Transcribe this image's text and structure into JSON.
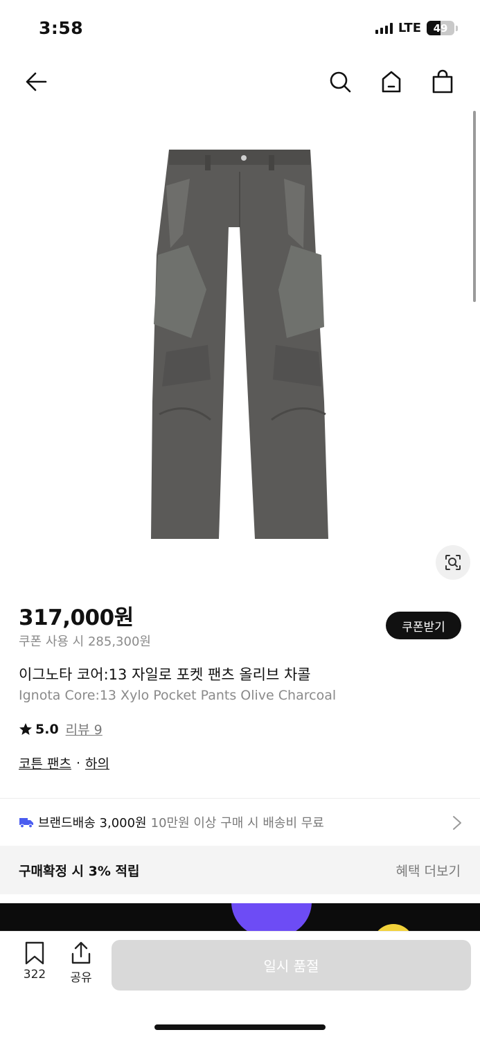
{
  "status_bar": {
    "time": "3:58",
    "network": "LTE",
    "battery": "49",
    "battery_level": 0.49
  },
  "nav": {
    "icons": [
      "back-arrow-icon",
      "search-icon",
      "home-icon",
      "shopping-bag-icon"
    ]
  },
  "product": {
    "image": "charcoal-cargo-pants",
    "price": "317,000원",
    "coupon_price": "쿠폰 사용 시 285,300원",
    "coupon_button": "쿠폰받기",
    "name_ko": "이그노타 코어:13 자일로 포켓 팬츠 올리브 차콜",
    "name_en": "Ignota Core:13 Xylo Pocket Pants Olive Charcoal",
    "rating": "5.0",
    "reviews": "리뷰 9",
    "category_1": "코튼 팬츠",
    "category_separator": "·",
    "category_2": "하의"
  },
  "shipping": {
    "label": "브랜드배송 3,000원",
    "note": "10만원 이상 구매 시 배송비 무료"
  },
  "points": {
    "label": "구매확정 시 3% 적립",
    "benefits_link": "혜택 더보기"
  },
  "bottom_bar": {
    "like_count": "322",
    "share_label": "공유",
    "buy_button": "일시 품절"
  },
  "colors": {
    "text": "#111111",
    "muted": "#8a8a8a",
    "accent_shipping": "#4a5cf0",
    "disabled_button": "#d9d9d9",
    "coupon_button": "#111111"
  }
}
